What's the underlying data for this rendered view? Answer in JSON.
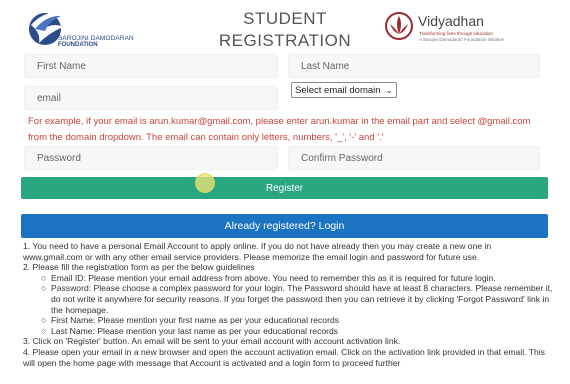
{
  "header": {
    "title_line1": "STUDENT",
    "title_line2": "REGISTRATION",
    "left_logo": {
      "line1": "SAROJINI DAMODARAN",
      "line2": "FOUNDATION",
      "icon": "bird-logo-icon"
    },
    "right_logo": {
      "brand": "Vidyadhan",
      "tagline1": "Transforming lives through education",
      "tagline2": "A Sarojini Damodaran Foundation initiative",
      "icon": "lotus-logo-icon"
    }
  },
  "form": {
    "first_name_placeholder": "First Name",
    "last_name_placeholder": "Last Name",
    "email_placeholder": "email",
    "email_domain_select": "Select email domain",
    "email_note": "For example, if your email is arun.kumar@gmail.com, please enter arun.kumar in the email part and select @gmail.com from the domain dropdown. The email can contain only letters, numbers, '_', '-' and '.'",
    "password_placeholder": "Password",
    "confirm_password_placeholder": "Confirm Password",
    "register_label": "Register",
    "already_registered_label": "Already registered? Login"
  },
  "instructions": [
    "1. You need to have a personal Email Account to apply online. If you do not have already then you may create a new one in www.gmail.com or with any other email service providers. Please memorize the email login and password for future use.",
    "2. Please fill the registration form as per the below guidelines",
    "Email ID: Please mention your email address from above. You need to remember this as it is required for future login.",
    "Password: Please choose a complex password for your login. The Password should have at least 8 characters. Please remember it, do not write it anywhere for security reasons. If you forget the password then you can retrieve it by clicking 'Forgot Password' link in the homepage.",
    "First Name: Please mention your first name as per your educational records",
    "Last Name: Please mention your last name as per your educational records",
    "3. Click on 'Register' button. An email will be sent to your email account with account activation link.",
    "4. Please open your email in a new browser and open the account activation email. Click on the activation link provided in that email. This will open the home page with message that Account is activated and a login form to proceed further"
  ],
  "colors": {
    "register": "#2aa581",
    "login": "#1b73c2",
    "note": "#c9443b"
  }
}
